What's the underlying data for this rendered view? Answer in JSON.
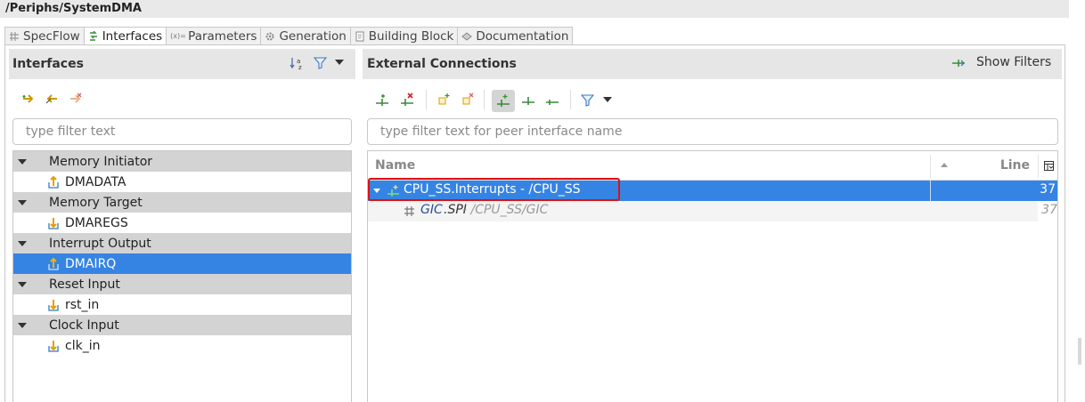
{
  "window": {
    "title": "/Periphs/SystemDMA"
  },
  "tabs": [
    {
      "label": "SpecFlow",
      "icon": "grid-icon",
      "active": false
    },
    {
      "label": "Interfaces",
      "icon": "interfaces-icon",
      "active": true
    },
    {
      "label": "Parameters",
      "icon": "parameters-icon",
      "active": false
    },
    {
      "label": "Generation",
      "icon": "gear-icon",
      "active": false
    },
    {
      "label": "Building Block",
      "icon": "document-icon",
      "active": false
    },
    {
      "label": "Documentation",
      "icon": "book-icon",
      "active": false
    }
  ],
  "left_panel": {
    "title": "Interfaces",
    "filter_placeholder": "type filter text",
    "tree": [
      {
        "group": "Memory Initiator",
        "items": [
          {
            "label": "DMADATA",
            "selected": false
          }
        ]
      },
      {
        "group": "Memory Target",
        "items": [
          {
            "label": "DMAREGS",
            "selected": false
          }
        ]
      },
      {
        "group": "Interrupt Output",
        "items": [
          {
            "label": "DMAIRQ",
            "selected": true
          }
        ]
      },
      {
        "group": "Reset Input",
        "items": [
          {
            "label": "rst_in",
            "selected": false
          }
        ]
      },
      {
        "group": "Clock Input",
        "items": [
          {
            "label": "clk_in",
            "selected": false
          }
        ]
      }
    ]
  },
  "right_panel": {
    "title": "External Connections",
    "show_filters_label": "Show Filters",
    "filter_placeholder": "type filter text for peer interface name",
    "table": {
      "columns": [
        "Name",
        "Line"
      ],
      "rows": [
        {
          "name": "CPU_SS.Interrupts - /CPU_SS",
          "line": "37",
          "selected": true,
          "expanded": true
        },
        {
          "name_prefix": "GIC",
          "name_suffix": ".SPI",
          "path": " - /CPU_SS/GIC",
          "line": "37",
          "child": true
        }
      ]
    }
  },
  "colors": {
    "selection": "#3584e4",
    "highlight_border": "#e01010",
    "group_bg": "#d3d3d3"
  }
}
